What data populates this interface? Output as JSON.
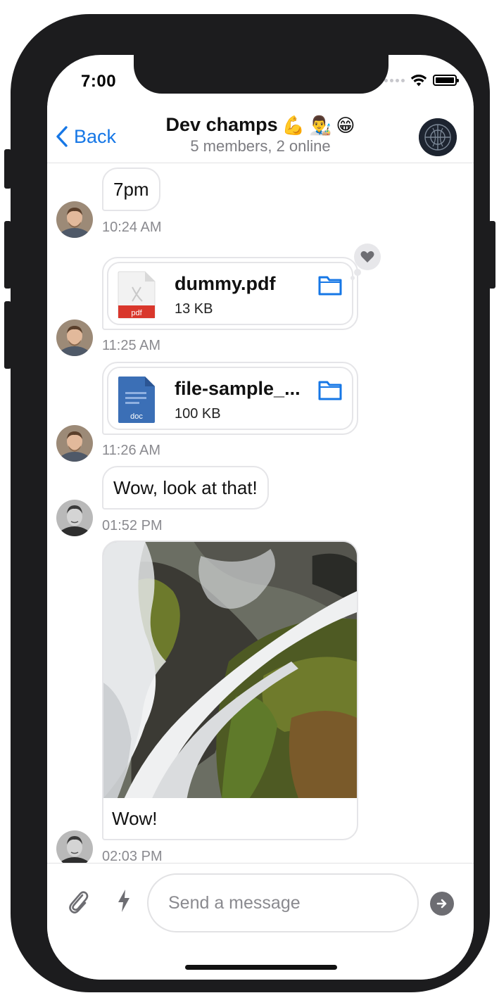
{
  "status_bar": {
    "time": "7:00"
  },
  "header": {
    "back_label": "Back",
    "title": "Dev champs",
    "title_emojis": [
      "💪",
      "👨‍🎨",
      "😁"
    ],
    "subtitle": "5 members, 2 online"
  },
  "messages": [
    {
      "type": "text",
      "text": "7pm",
      "time": "10:24 AM"
    },
    {
      "type": "file",
      "file_name": "dummy.pdf",
      "file_size": "13 KB",
      "file_type": "pdf",
      "time": "11:25 AM",
      "reaction": "heart-icon"
    },
    {
      "type": "file",
      "file_name": "file-sample_...",
      "file_size": "100 KB",
      "file_type": "doc",
      "time": "11:26 AM"
    },
    {
      "type": "text",
      "text": "Wow, look at that!",
      "time": "01:52 PM"
    },
    {
      "type": "image",
      "caption": "Wow!",
      "time": "02:03 PM"
    }
  ],
  "composer": {
    "placeholder": "Send a message"
  },
  "colors": {
    "accent": "#1677e6",
    "pdf_red": "#d9372c",
    "doc_blue": "#3b6fb6"
  }
}
